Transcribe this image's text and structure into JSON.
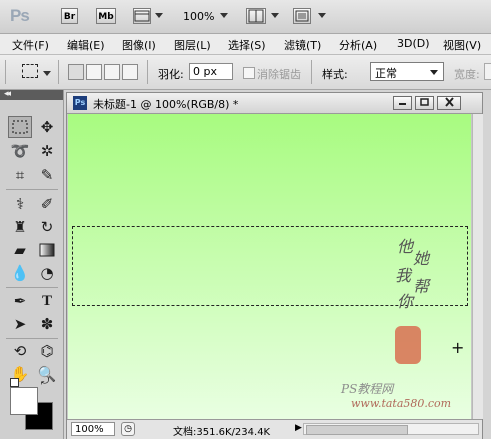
{
  "app": {
    "logo_text": "Ps",
    "bridge_label": "Br",
    "minibridge_label": "Mb",
    "zoom_level": "100%"
  },
  "menu": {
    "items": [
      {
        "label": "文件(F)"
      },
      {
        "label": "编辑(E)"
      },
      {
        "label": "图像(I)"
      },
      {
        "label": "图层(L)"
      },
      {
        "label": "选择(S)"
      },
      {
        "label": "滤镜(T)"
      },
      {
        "label": "分析(A)"
      },
      {
        "label": "3D(D)"
      },
      {
        "label": "视图(V)"
      }
    ]
  },
  "options": {
    "feather_label": "羽化:",
    "feather_value": "0 px",
    "antialias_label": "消除锯齿",
    "style_label": "样式:",
    "style_value": "正常",
    "width_label": "宽度:"
  },
  "document": {
    "title": "未标题-1 @ 100%(RGB/8) *",
    "badge": "Ps"
  },
  "canvas_art": {
    "calligraphy": [
      "他",
      "她",
      "我",
      "帮",
      "你"
    ],
    "watermark_line1": "PS教程网",
    "watermark_line2": "www.tata580.com"
  },
  "status": {
    "zoom": "100%",
    "doc_info": "文档:351.6K/234.4K",
    "arrow": "▶"
  },
  "colors": {
    "canvas_top": "#a8fb80",
    "canvas_bottom": "#e9ffe2",
    "foreground": "#ffffff",
    "background": "#000000"
  }
}
